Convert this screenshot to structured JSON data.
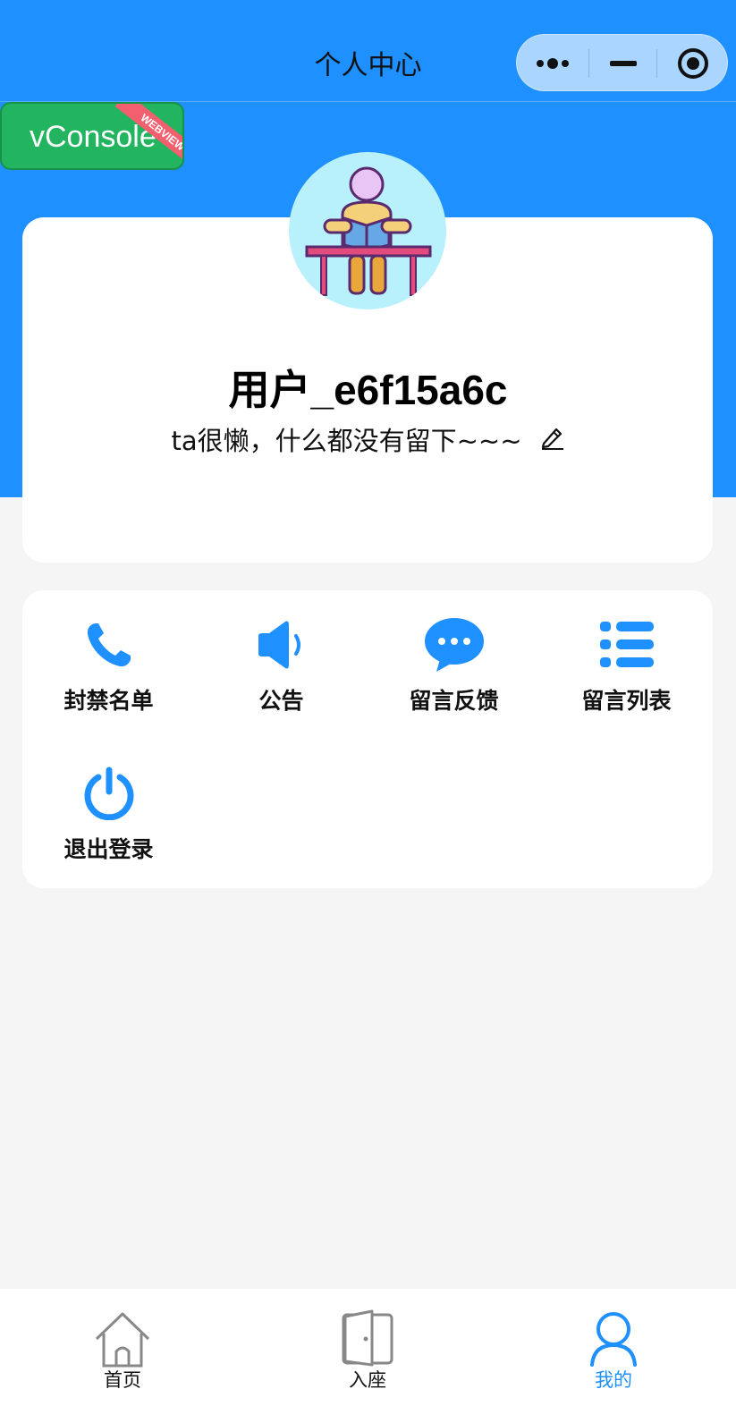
{
  "navbar": {
    "title": "个人中心"
  },
  "vconsole": {
    "label": "vConsole",
    "ribbon": "WEBVIEW"
  },
  "profile": {
    "username": "用户_e6f15a6c",
    "bio": "ta很懒，什么都没有留下~~~"
  },
  "menu": {
    "items": [
      {
        "label": "封禁名单",
        "icon": "phone-icon"
      },
      {
        "label": "公告",
        "icon": "speaker-icon"
      },
      {
        "label": "留言反馈",
        "icon": "chat-bubble-icon"
      },
      {
        "label": "留言列表",
        "icon": "list-icon"
      },
      {
        "label": "退出登录",
        "icon": "power-icon"
      }
    ]
  },
  "tabbar": {
    "items": [
      {
        "label": "首页",
        "icon": "home-icon",
        "active": false
      },
      {
        "label": "入座",
        "icon": "door-icon",
        "active": false
      },
      {
        "label": "我的",
        "icon": "user-icon",
        "active": true
      }
    ]
  },
  "colors": {
    "primary": "#1e90ff",
    "background": "#f5f5f5",
    "vconsole": "#22b45f"
  }
}
